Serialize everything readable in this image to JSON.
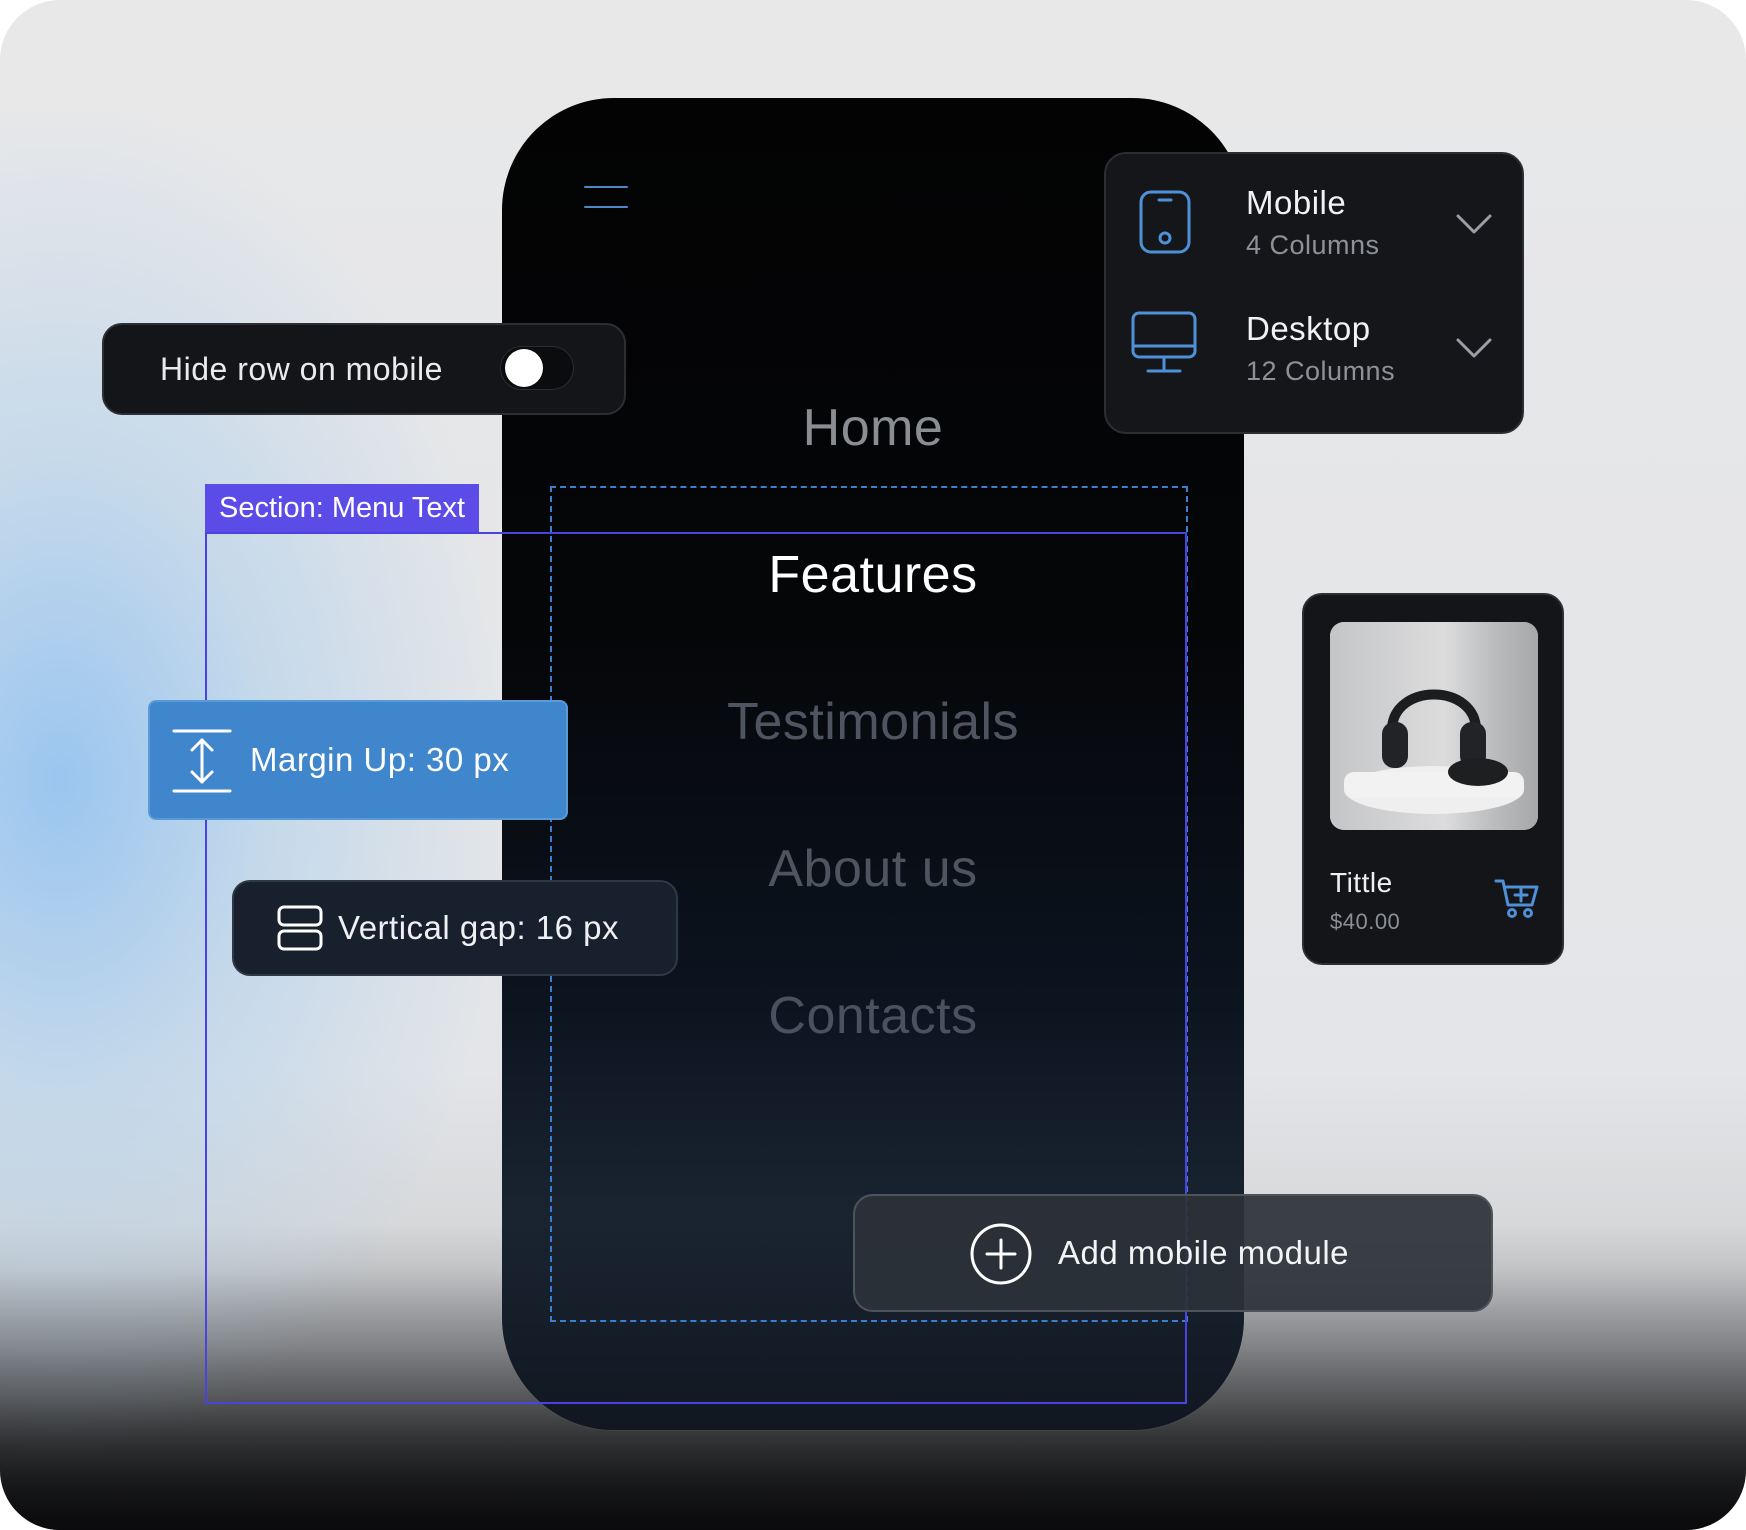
{
  "toggle": {
    "label": "Hide row on mobile",
    "on": false
  },
  "breakpoints": [
    {
      "name": "Mobile",
      "columns": "4 Columns",
      "icon": "smartphone-icon"
    },
    {
      "name": "Desktop",
      "columns": "12 Columns",
      "icon": "monitor-icon"
    }
  ],
  "menu": {
    "icon": "hamburger-menu-icon",
    "items": [
      "Home",
      "Features",
      "Testimonials",
      "About us",
      "Contacts"
    ],
    "active": "Features"
  },
  "section": {
    "tag": "Section: Menu Text"
  },
  "margin": {
    "label": "Margin Up: 30 px",
    "icon": "vertical-resize-icon"
  },
  "gap": {
    "label": "Vertical gap: 16 px",
    "icon": "rows-layout-icon"
  },
  "product": {
    "title": "Tittle",
    "price": "$40.00",
    "icon": "add-to-cart-icon"
  },
  "add_module": {
    "label": "Add mobile module",
    "icon": "plus-circle-icon"
  },
  "colors": {
    "accent_blue": "#3f86cc",
    "section_purple": "#5b4ce8",
    "panel_dark": "#151619",
    "phone_dark": "#030304"
  }
}
